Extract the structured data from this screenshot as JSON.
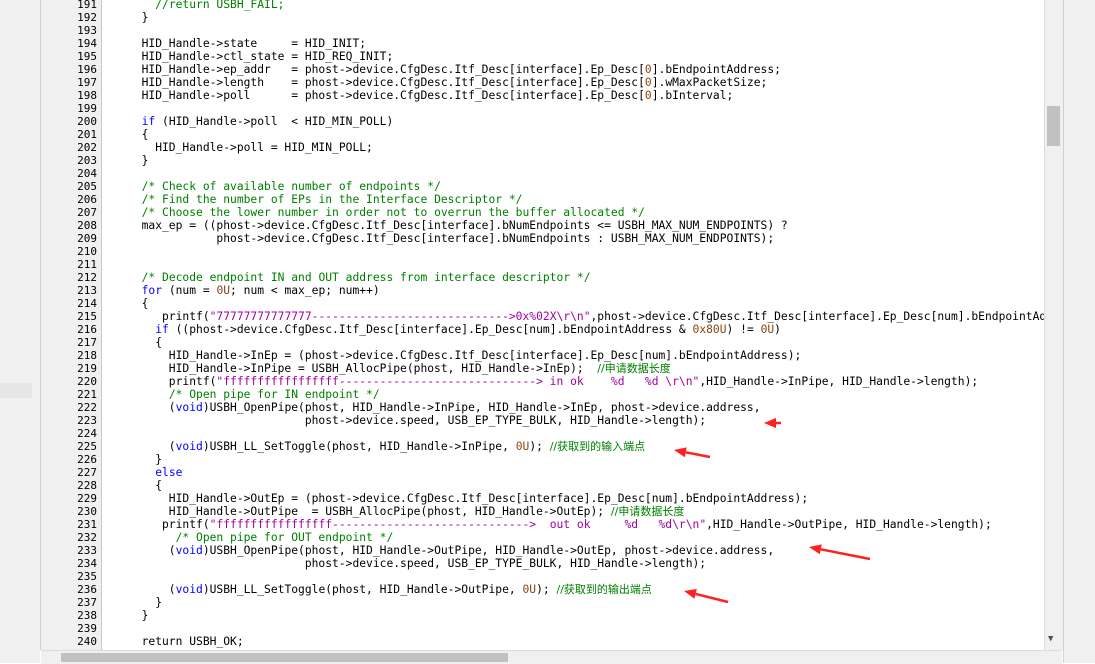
{
  "editor": {
    "lines": [
      {
        "n": "191",
        "fold": "",
        "segs": [
          [
            "    ",
            ""
          ],
          [
            "//return USBH_FAIL;",
            "cm"
          ]
        ]
      },
      {
        "n": "192",
        "fold": "",
        "segs": [
          [
            "  }",
            ""
          ]
        ]
      },
      {
        "n": "193",
        "fold": "",
        "segs": [
          [
            "",
            ""
          ]
        ]
      },
      {
        "n": "194",
        "fold": "",
        "segs": [
          [
            "  HID_Handle->state     = HID_INIT;",
            ""
          ]
        ]
      },
      {
        "n": "195",
        "fold": "",
        "segs": [
          [
            "  HID_Handle->ctl_state = HID_REQ_INIT;",
            ""
          ]
        ]
      },
      {
        "n": "196",
        "fold": "",
        "segs": [
          [
            "  HID_Handle->ep_addr   = phost->device.CfgDesc.Itf_Desc[interface].Ep_Desc[",
            ""
          ],
          [
            "0",
            "num"
          ],
          [
            "].bEndpointAddress;",
            ""
          ]
        ]
      },
      {
        "n": "197",
        "fold": "",
        "segs": [
          [
            "  HID_Handle->length    = phost->device.CfgDesc.Itf_Desc[interface].Ep_Desc[",
            ""
          ],
          [
            "0",
            "num"
          ],
          [
            "].wMaxPacketSize;",
            ""
          ]
        ]
      },
      {
        "n": "198",
        "fold": "",
        "segs": [
          [
            "  HID_Handle->poll      = phost->device.CfgDesc.Itf_Desc[interface].Ep_Desc[",
            ""
          ],
          [
            "0",
            "num"
          ],
          [
            "].bInterval;",
            ""
          ]
        ]
      },
      {
        "n": "199",
        "fold": "",
        "segs": [
          [
            "",
            ""
          ]
        ]
      },
      {
        "n": "200",
        "fold": "",
        "segs": [
          [
            "  ",
            ""
          ],
          [
            "if",
            "kw"
          ],
          [
            " (HID_Handle->poll  < HID_MIN_POLL)",
            ""
          ]
        ]
      },
      {
        "n": "201",
        "fold": "box",
        "segs": [
          [
            "  {",
            ""
          ]
        ]
      },
      {
        "n": "202",
        "fold": "",
        "segs": [
          [
            "    HID_Handle->poll = HID_MIN_POLL;",
            ""
          ]
        ]
      },
      {
        "n": "203",
        "fold": "",
        "segs": [
          [
            "  }",
            ""
          ]
        ]
      },
      {
        "n": "204",
        "fold": "",
        "segs": [
          [
            "",
            ""
          ]
        ]
      },
      {
        "n": "205",
        "fold": "",
        "segs": [
          [
            "  ",
            ""
          ],
          [
            "/* Check of available number of endpoints */",
            "cm"
          ]
        ]
      },
      {
        "n": "206",
        "fold": "",
        "segs": [
          [
            "  ",
            ""
          ],
          [
            "/* Find the number of EPs in the Interface Descriptor */",
            "cm"
          ]
        ]
      },
      {
        "n": "207",
        "fold": "",
        "segs": [
          [
            "  ",
            ""
          ],
          [
            "/* Choose the lower number in order not to overrun the buffer allocated */",
            "cm"
          ]
        ]
      },
      {
        "n": "208",
        "fold": "",
        "segs": [
          [
            "  max_ep = ((phost->device.CfgDesc.Itf_Desc[interface].bNumEndpoints <= USBH_MAX_NUM_ENDPOINTS) ?",
            ""
          ]
        ]
      },
      {
        "n": "209",
        "fold": "",
        "segs": [
          [
            "             phost->device.CfgDesc.Itf_Desc[interface].bNumEndpoints : USBH_MAX_NUM_ENDPOINTS);",
            ""
          ]
        ]
      },
      {
        "n": "210",
        "fold": "",
        "segs": [
          [
            "",
            ""
          ]
        ]
      },
      {
        "n": "211",
        "fold": "",
        "segs": [
          [
            "",
            ""
          ]
        ]
      },
      {
        "n": "212",
        "fold": "",
        "segs": [
          [
            "  ",
            ""
          ],
          [
            "/* Decode endpoint IN and OUT address from interface descriptor */",
            "cm"
          ]
        ]
      },
      {
        "n": "213",
        "fold": "",
        "segs": [
          [
            "  ",
            ""
          ],
          [
            "for",
            "kw"
          ],
          [
            " (num = ",
            ""
          ],
          [
            "0U",
            "num"
          ],
          [
            "; num < max_ep; num++)",
            ""
          ]
        ]
      },
      {
        "n": "214",
        "fold": "box",
        "segs": [
          [
            "  {",
            ""
          ]
        ]
      },
      {
        "n": "215",
        "fold": "",
        "segs": [
          [
            "     printf(",
            ""
          ],
          [
            "\"77777777777777----------------------------->0x%02X\\r\\n\"",
            "str"
          ],
          [
            ",phost->device.CfgDesc.Itf_Desc[interface].Ep_Desc[num].bEndpointAddress);",
            ""
          ]
        ]
      },
      {
        "n": "216",
        "fold": "",
        "segs": [
          [
            "    ",
            ""
          ],
          [
            "if",
            "kw"
          ],
          [
            " ((phost->device.CfgDesc.Itf_Desc[interface].Ep_Desc[num].bEndpointAddress & ",
            ""
          ],
          [
            "0x80U",
            "num"
          ],
          [
            ") != ",
            ""
          ],
          [
            "0U",
            "num"
          ],
          [
            ")",
            ""
          ]
        ]
      },
      {
        "n": "217",
        "fold": "box",
        "segs": [
          [
            "    {",
            ""
          ]
        ]
      },
      {
        "n": "218",
        "fold": "",
        "segs": [
          [
            "      HID_Handle->InEp = (phost->device.CfgDesc.Itf_Desc[interface].Ep_Desc[num].bEndpointAddress);",
            ""
          ]
        ]
      },
      {
        "n": "219",
        "fold": "",
        "segs": [
          [
            "      HID_Handle->InPipe = USBH_AllocPipe(phost, HID_Handle->InEp);  ",
            ""
          ],
          [
            "//申请数据长度",
            "cm cjk"
          ]
        ]
      },
      {
        "n": "220",
        "fold": "",
        "segs": [
          [
            "      printf(",
            ""
          ],
          [
            "\"fffffffffffffffff-----------------------------> in ok    %d   %d \\r\\n\"",
            "str"
          ],
          [
            ",HID_Handle->InPipe, HID_Handle->length);",
            ""
          ]
        ]
      },
      {
        "n": "221",
        "fold": "",
        "segs": [
          [
            "      ",
            ""
          ],
          [
            "/* Open pipe for IN endpoint */",
            "cm"
          ]
        ]
      },
      {
        "n": "222",
        "fold": "box",
        "segs": [
          [
            "      (",
            ""
          ],
          [
            "void",
            "kw"
          ],
          [
            ")USBH_OpenPipe(phost, HID_Handle->InPipe, HID_Handle->InEp, phost->device.address,",
            ""
          ]
        ]
      },
      {
        "n": "223",
        "fold": "",
        "segs": [
          [
            "                          phost->device.speed, USB_EP_TYPE_BULK, HID_Handle->length);",
            ""
          ]
        ]
      },
      {
        "n": "224",
        "fold": "",
        "segs": [
          [
            "",
            ""
          ]
        ]
      },
      {
        "n": "225",
        "fold": "",
        "segs": [
          [
            "      (",
            ""
          ],
          [
            "void",
            "kw"
          ],
          [
            ")USBH_LL_SetToggle(phost, HID_Handle->InPipe, ",
            ""
          ],
          [
            "0U",
            "num"
          ],
          [
            "); ",
            ""
          ],
          [
            "//获取到的输入端点",
            "cm cjk"
          ]
        ]
      },
      {
        "n": "226",
        "fold": "",
        "segs": [
          [
            "    }",
            ""
          ]
        ]
      },
      {
        "n": "227",
        "fold": "",
        "segs": [
          [
            "    ",
            ""
          ],
          [
            "else",
            "kw"
          ]
        ]
      },
      {
        "n": "228",
        "fold": "box",
        "segs": [
          [
            "    {",
            ""
          ]
        ]
      },
      {
        "n": "229",
        "fold": "",
        "segs": [
          [
            "      HID_Handle->OutEp = (phost->device.CfgDesc.Itf_Desc[interface].Ep_Desc[num].bEndpointAddress);",
            ""
          ]
        ]
      },
      {
        "n": "230",
        "fold": "",
        "segs": [
          [
            "      HID_Handle->OutPipe  = USBH_AllocPipe(phost, HID_Handle->OutEp); ",
            ""
          ],
          [
            "//申请数据长度",
            "cm cjk"
          ]
        ]
      },
      {
        "n": "231",
        "fold": "",
        "segs": [
          [
            "     printf(",
            ""
          ],
          [
            "\"fffffffffffffffff----------------------------->  out ok     %d   %d\\r\\n\"",
            "str"
          ],
          [
            ",HID_Handle->OutPipe, HID_Handle->length);",
            ""
          ]
        ]
      },
      {
        "n": "232",
        "fold": "",
        "segs": [
          [
            "       ",
            ""
          ],
          [
            "/* Open pipe for OUT endpoint */",
            "cm"
          ]
        ]
      },
      {
        "n": "233",
        "fold": "box",
        "segs": [
          [
            "      (",
            ""
          ],
          [
            "void",
            "kw"
          ],
          [
            ")USBH_OpenPipe(phost, HID_Handle->OutPipe, HID_Handle->OutEp, phost->device.address,",
            ""
          ]
        ]
      },
      {
        "n": "234",
        "fold": "",
        "segs": [
          [
            "                          phost->device.speed, USB_EP_TYPE_BULK, HID_Handle->length);",
            ""
          ]
        ]
      },
      {
        "n": "235",
        "fold": "",
        "segs": [
          [
            "",
            ""
          ]
        ]
      },
      {
        "n": "236",
        "fold": "",
        "segs": [
          [
            "      (",
            ""
          ],
          [
            "void",
            "kw"
          ],
          [
            ")USBH_LL_SetToggle(phost, HID_Handle->OutPipe, ",
            ""
          ],
          [
            "0U",
            "num"
          ],
          [
            "); ",
            ""
          ],
          [
            "//获取到的输出端点",
            "cm cjk"
          ]
        ]
      },
      {
        "n": "237",
        "fold": "",
        "segs": [
          [
            "    }",
            ""
          ]
        ]
      },
      {
        "n": "238",
        "fold": "",
        "segs": [
          [
            "  }",
            ""
          ]
        ]
      },
      {
        "n": "239",
        "fold": "",
        "segs": [
          [
            "",
            ""
          ]
        ]
      },
      {
        "n": "240",
        "fold": "",
        "segs": [
          [
            "  return USBH_OK;",
            ""
          ]
        ]
      }
    ]
  },
  "annotations": {
    "arrows_color": "#ff2020",
    "arrow_icon": "red-arrow-icon"
  },
  "colors": {
    "keyword": "#0000ff",
    "comment": "#008000",
    "string": "#a000a0",
    "number": "#8b4513"
  }
}
